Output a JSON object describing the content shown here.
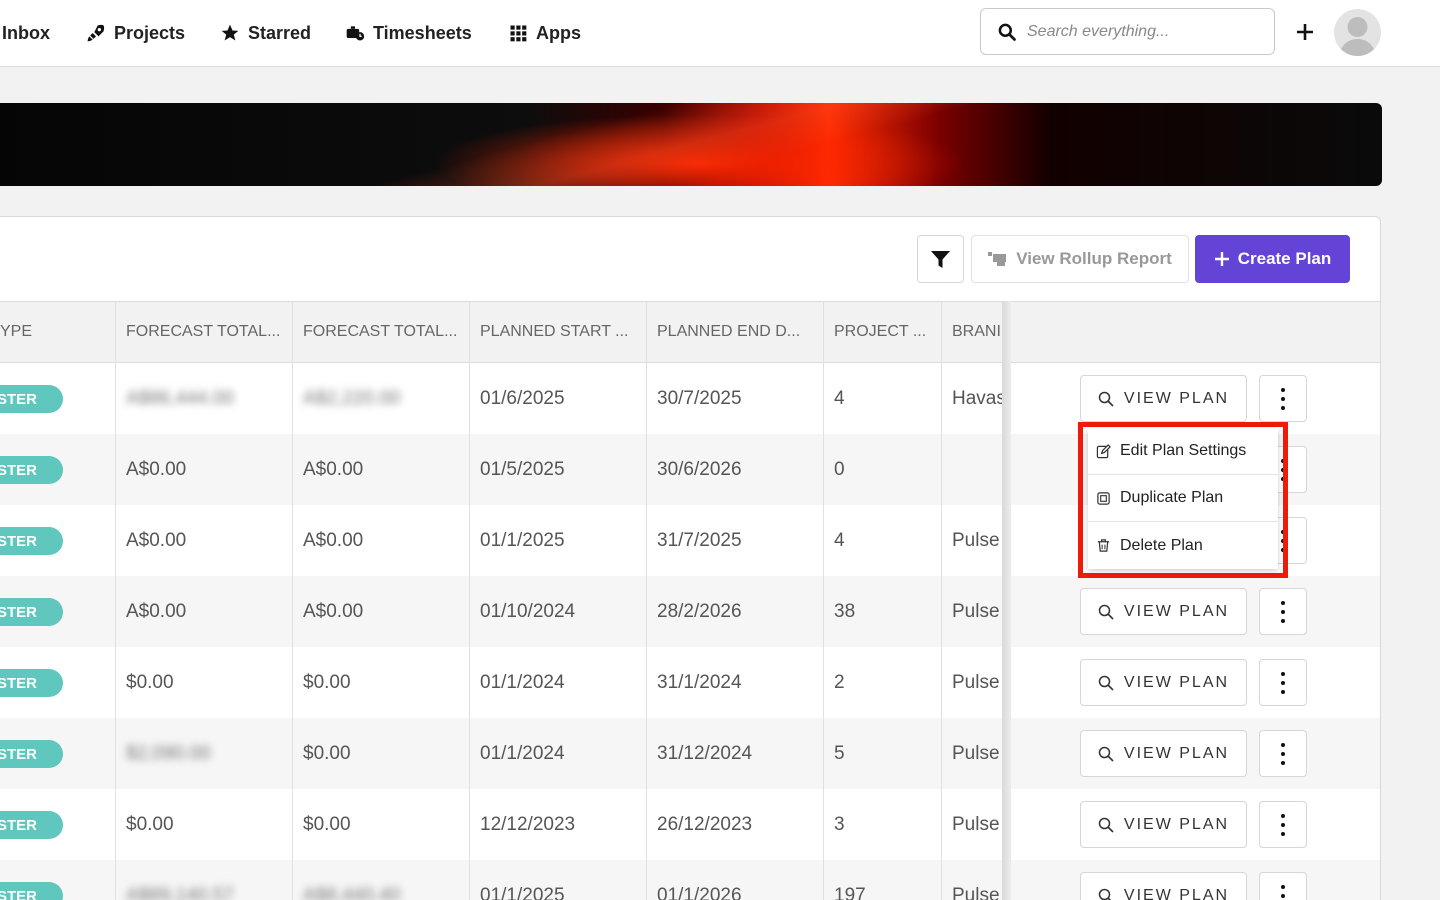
{
  "nav": {
    "items": [
      {
        "label": "Inbox",
        "icon": "inbox-icon"
      },
      {
        "label": "Projects",
        "icon": "rocket-icon"
      },
      {
        "label": "Starred",
        "icon": "star-icon"
      },
      {
        "label": "Timesheets",
        "icon": "timesheet-icon"
      },
      {
        "label": "Apps",
        "icon": "grid-icon"
      }
    ],
    "search_placeholder": "Search everything..."
  },
  "toolbar": {
    "rollup_label": "View Rollup Report",
    "create_label": "Create Plan"
  },
  "table": {
    "headers": [
      "YPE",
      "FORECAST TOTAL...",
      "FORECAST TOTAL...",
      "PLANNED START ...",
      "PLANNED END D...",
      "PROJECT ...",
      "BRANI"
    ],
    "badge_label": "STER",
    "view_label": "VIEW PLAN",
    "rows": [
      {
        "f1": "A$86,444.00",
        "f2": "A$2,220.00",
        "start": "01/6/2025",
        "end": "30/7/2025",
        "projects": "4",
        "brand": "Havas",
        "blur1": true,
        "blur2": true
      },
      {
        "f1": "A$0.00",
        "f2": "A$0.00",
        "start": "01/5/2025",
        "end": "30/6/2026",
        "projects": "0",
        "brand": "",
        "blur1": false,
        "blur2": false
      },
      {
        "f1": "A$0.00",
        "f2": "A$0.00",
        "start": "01/1/2025",
        "end": "31/7/2025",
        "projects": "4",
        "brand": "Pulse",
        "blur1": false,
        "blur2": false
      },
      {
        "f1": "A$0.00",
        "f2": "A$0.00",
        "start": "01/10/2024",
        "end": "28/2/2026",
        "projects": "38",
        "brand": "Pulse",
        "blur1": false,
        "blur2": false
      },
      {
        "f1": "$0.00",
        "f2": "$0.00",
        "start": "01/1/2024",
        "end": "31/1/2024",
        "projects": "2",
        "brand": "Pulse",
        "blur1": false,
        "blur2": false
      },
      {
        "f1": "$2,090.00",
        "f2": "$0.00",
        "start": "01/1/2024",
        "end": "31/12/2024",
        "projects": "5",
        "brand": "Pulse",
        "blur1": true,
        "blur2": false
      },
      {
        "f1": "$0.00",
        "f2": "$0.00",
        "start": "12/12/2023",
        "end": "26/12/2023",
        "projects": "3",
        "brand": "Pulse",
        "blur1": false,
        "blur2": false
      },
      {
        "f1": "A$89,140.57",
        "f2": "A$8,440.40",
        "start": "01/1/2025",
        "end": "01/1/2026",
        "projects": "197",
        "brand": "Pulse",
        "blur1": true,
        "blur2": true
      }
    ]
  },
  "menu": {
    "items": [
      {
        "label": "Edit Plan Settings",
        "icon": "edit-icon"
      },
      {
        "label": "Duplicate Plan",
        "icon": "duplicate-icon"
      },
      {
        "label": "Delete Plan",
        "icon": "trash-icon"
      }
    ]
  },
  "colors": {
    "accent": "#6444d6",
    "badge": "#5fc7bd",
    "highlight": "#f01a0a"
  }
}
